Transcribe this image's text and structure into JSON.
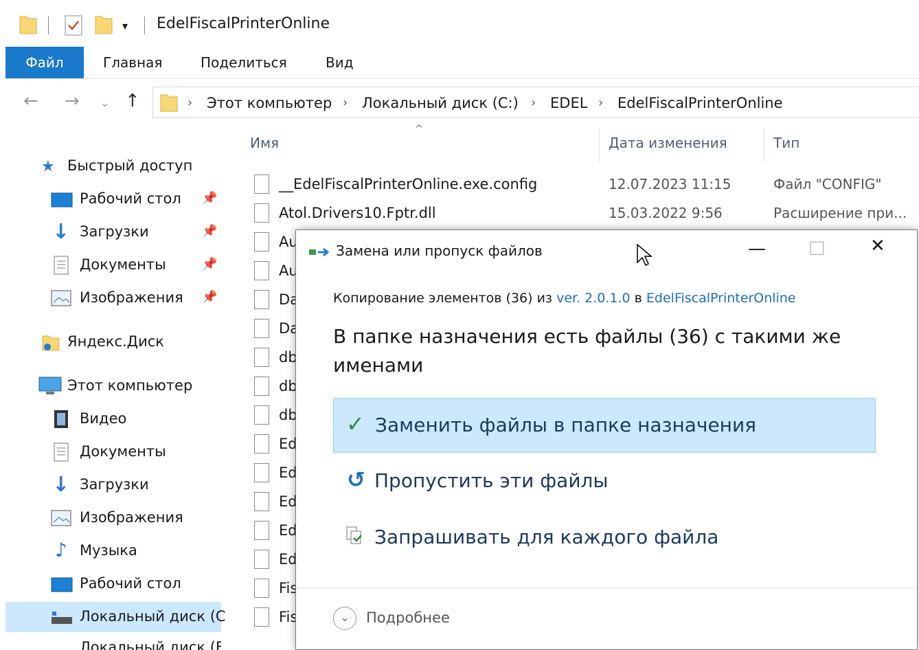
{
  "window": {
    "title": "EdelFiscalPrinterOnline"
  },
  "ribbon": {
    "tabs": [
      "Файл",
      "Главная",
      "Поделиться",
      "Вид"
    ]
  },
  "address": {
    "crumbs": [
      "Этот компьютер",
      "Локальный диск (C:)",
      "EDEL",
      "EdelFiscalPrinterOnline"
    ]
  },
  "sidebar": {
    "quick_access": "Быстрый доступ",
    "quick_items": [
      "Рабочий стол",
      "Загрузки",
      "Документы",
      "Изображения"
    ],
    "yandex": "Яндекс.Диск",
    "this_pc": "Этот компьютер",
    "pc_items": [
      "Видео",
      "Документы",
      "Загрузки",
      "Изображения",
      "Музыка",
      "Рабочий стол",
      "Локальный диск (C",
      "Локальный диск (F"
    ]
  },
  "filelist": {
    "columns": {
      "name": "Имя",
      "date": "Дата изменения",
      "type": "Тип"
    },
    "rows": [
      {
        "name": "__EdelFiscalPrinterOnline.exe.config",
        "date": "12.07.2023 11:15",
        "type": "Файл \"CONFIG\""
      },
      {
        "name": "Atol.Drivers10.Fptr.dll",
        "date": "15.03.2022 9:56",
        "type": "Расширение при..."
      },
      {
        "name": "Au",
        "date": "",
        "type": ""
      },
      {
        "name": "Au",
        "date": "",
        "type": ""
      },
      {
        "name": "Da",
        "date": "",
        "type": ""
      },
      {
        "name": "Da",
        "date": "",
        "type": ""
      },
      {
        "name": "db",
        "date": "",
        "type": ""
      },
      {
        "name": "db",
        "date": "",
        "type": ""
      },
      {
        "name": "db",
        "date": "",
        "type": ""
      },
      {
        "name": "Ed",
        "date": "",
        "type": ""
      },
      {
        "name": "Ed",
        "date": "",
        "type": ""
      },
      {
        "name": "Ed",
        "date": "",
        "type": ""
      },
      {
        "name": "Ed",
        "date": "",
        "type": ""
      },
      {
        "name": "Ed",
        "date": "",
        "type": ""
      },
      {
        "name": "Fis",
        "date": "",
        "type": ""
      },
      {
        "name": "Fis",
        "date": "",
        "type": ""
      }
    ]
  },
  "dialog": {
    "title": "Замена или пропуск файлов",
    "sub_prefix": "Копирование элементов (36) из ",
    "sub_source": "ver. 2.0.1.0",
    "sub_mid": " в ",
    "sub_dest": "EdelFiscalPrinterOnline",
    "heading": "В папке назначения есть файлы (36) с такими же именами",
    "options": {
      "replace": "Заменить файлы в папке назначения",
      "skip": "Пропустить эти файлы",
      "ask": "Запрашивать для каждого файла"
    },
    "more": "Подробнее"
  },
  "colors": {
    "accent": "#1979ca",
    "selection": "#cce8ff",
    "link": "#1c6fbf",
    "check": "#2e8b3a"
  }
}
